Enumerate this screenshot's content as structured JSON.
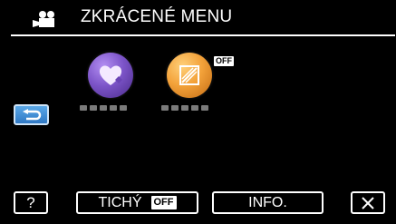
{
  "header": {
    "title": "ZKRÁCENÉ MENU",
    "mode_icon": "video-camera-icon"
  },
  "apps": [
    {
      "icon": "heart-icon",
      "label_placeholder": "■■■■■"
    },
    {
      "icon": "edit-icon",
      "label_placeholder": "■■■■■",
      "badge": "OFF"
    }
  ],
  "buttons": {
    "help": "?",
    "silent_label": "TICHÝ",
    "silent_state": "OFF",
    "info": "INFO.",
    "close_icon": "close-icon",
    "back_icon": "return-arrow-icon"
  },
  "colors": {
    "background": "#000000",
    "back_button": "#3e8fd8",
    "heart_app": "#7d55c9",
    "edit_app": "#f3a23a"
  }
}
